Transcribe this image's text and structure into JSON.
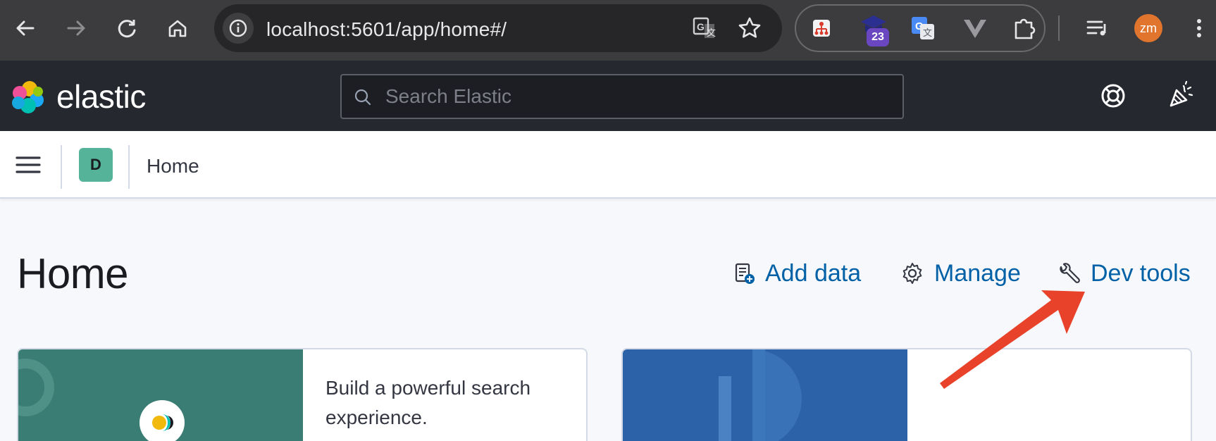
{
  "browser": {
    "url": "localhost:5601/app/home#/",
    "extension_badge": "23",
    "profile_initials": "zm"
  },
  "header": {
    "brand": "elastic",
    "search_placeholder": "Search Elastic"
  },
  "breadcrumb": {
    "space_initial": "D",
    "current": "Home"
  },
  "page": {
    "title": "Home",
    "actions": [
      {
        "label": "Add data",
        "icon": "add-data-icon"
      },
      {
        "label": "Manage",
        "icon": "gear-icon"
      },
      {
        "label": "Dev tools",
        "icon": "wrench-icon"
      }
    ]
  },
  "cards": [
    {
      "text": "Build a powerful search experience.",
      "color": "#3a7d74"
    },
    {
      "text": "",
      "color": "#2c62a8"
    }
  ],
  "colors": {
    "link": "#0061a6",
    "header_bg": "#25282f",
    "annotation_arrow": "#e8432a"
  }
}
